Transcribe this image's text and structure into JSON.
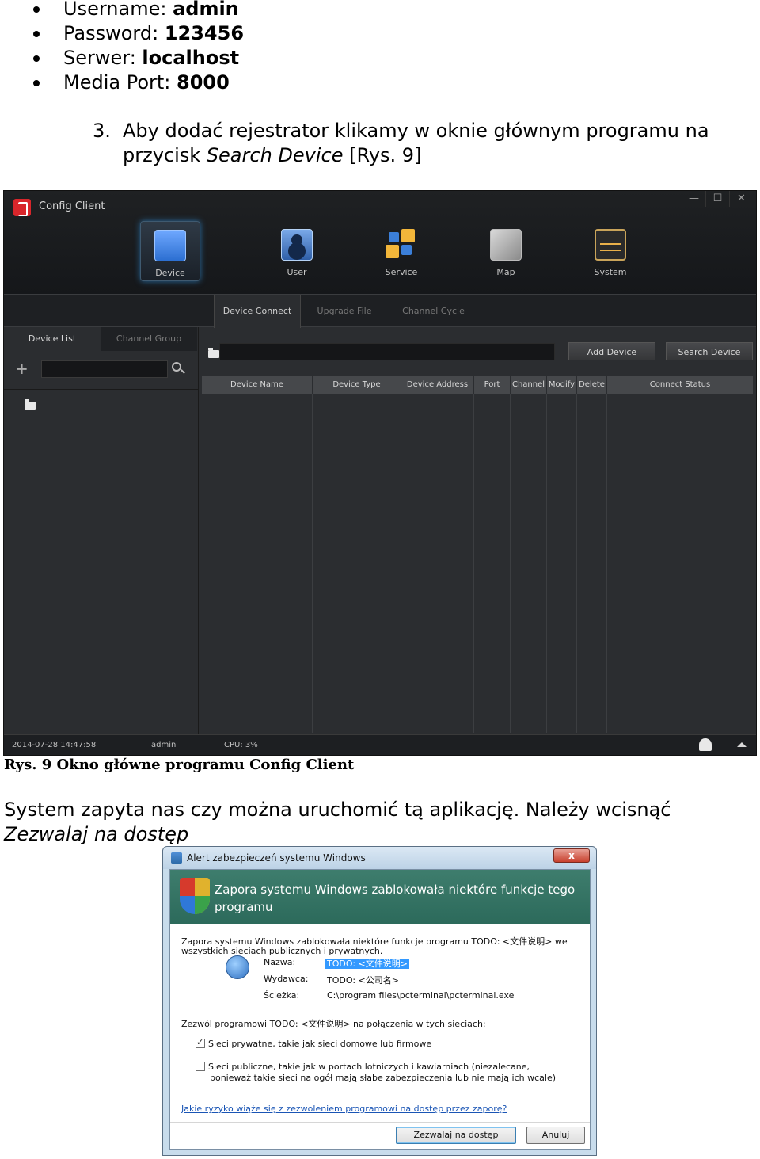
{
  "bullets": [
    {
      "label": "Username: ",
      "value": "admin"
    },
    {
      "label": "Password: ",
      "value": "123456"
    },
    {
      "label": "Serwer: ",
      "value": "localhost"
    },
    {
      "label": "Media Port: ",
      "value": "8000"
    }
  ],
  "step": {
    "number": "3.",
    "text": "Aby dodać rejestrator klikamy w oknie głównym programu na przycisk ",
    "italic": "Search Device",
    "tail": " [Rys. 9]"
  },
  "config_client": {
    "title": "Config Client",
    "window_buttons": [
      "—",
      "☐",
      "✕"
    ],
    "nav": [
      "Device",
      "User",
      "Service",
      "Map",
      "System"
    ],
    "subtabs": [
      "Device Connect",
      "Upgrade File",
      "Channel Cycle"
    ],
    "left_tabs": [
      "Device List",
      "Channel Group"
    ],
    "add_symbol": "+",
    "buttons": {
      "add": "Add Device",
      "search": "Search Device"
    },
    "columns": [
      "Device Name",
      "Device Type",
      "Device Address",
      "Port",
      "Channel",
      "Modify",
      "Delete",
      "Connect Status"
    ],
    "status": {
      "datetime": "2014-07-28 14:47:58",
      "user": "admin",
      "cpu": "CPU: 3%"
    }
  },
  "caption": "Rys. 9 Okno główne programu Config Client",
  "paragraph": {
    "text": "System zapyta nas czy można uruchomić tą aplikację. Należy wcisnąć ",
    "italic": "Zezwalaj na dostęp"
  },
  "dialog": {
    "title": "Alert zabezpieczeń systemu Windows",
    "close": "x",
    "header": "Zapora systemu Windows zablokowała niektóre funkcje tego programu",
    "intro_line1": "Zapora systemu Windows zablokowała niektóre funkcje programu TODO: <文件说明> we",
    "intro_line2": "wszystkich sieciach publicznych i prywatnych.",
    "name_label": "Nazwa:",
    "name_value": "TODO: <文件说明>",
    "publisher_label": "Wydawca:",
    "publisher_value": "TODO: <公司名>",
    "path_label": "Ścieżka:",
    "path_value": "C:\\program files\\pcterminal\\pcterminal.exe",
    "allow_text": "Zezwól programowi TODO: <文件说明> na połączenia w tych sieciach:",
    "private_label": "Sieci prywatne, takie jak sieci domowe lub firmowe",
    "private_checked": true,
    "public_line1": "Sieci publiczne, takie jak w portach lotniczych i kawiarniach (niezalecane,",
    "public_line2": "ponieważ takie sieci na ogół mają słabe zabezpieczenia lub nie mają ich wcale)",
    "public_checked": false,
    "risk_link": "Jakie ryzyko wiąże się z zezwoleniem programowi na dostęp przez zaporę?",
    "allow_button": "Zezwalaj na dostęp",
    "cancel_button": "Anuluj"
  }
}
